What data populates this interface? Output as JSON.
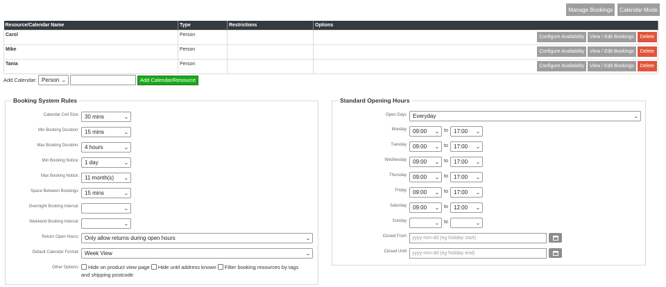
{
  "top_buttons": {
    "manage": "Manage Bookings",
    "mode": "Calendar Mode"
  },
  "table": {
    "headers": [
      "Resource/Calendar Name",
      "Type",
      "Restrictions",
      "Options"
    ],
    "rows": [
      {
        "name": "Carol",
        "type": "Person"
      },
      {
        "name": "Mike",
        "type": "Person"
      },
      {
        "name": "Tania",
        "type": "Person"
      }
    ],
    "actions": {
      "configure": "Configure Availability",
      "view_edit": "View / Edit Bookings",
      "delete": "Delete"
    }
  },
  "add_calendar": {
    "label": "Add Calendar:",
    "type_value": "Person",
    "name_value": "",
    "button": "Add Calendar/Resource"
  },
  "rules": {
    "title": "Booking System Rules",
    "fields": [
      {
        "label": "Calendar Cell Size:",
        "value": "30 mins"
      },
      {
        "label": "Min Booking Duration:",
        "value": "15 mins"
      },
      {
        "label": "Max Booking Duration:",
        "value": "4 hours"
      },
      {
        "label": "Min Booking Notice:",
        "value": "1 day"
      },
      {
        "label": "Max Booking Notice:",
        "value": "11 month(s)"
      },
      {
        "label": "Space Between Bookings:",
        "value": "15 mins"
      },
      {
        "label": "Overnight Booking Interval:",
        "value": ""
      },
      {
        "label": "Weekend Booking Interval:",
        "value": ""
      },
      {
        "label": "Return Open Hours:",
        "value": "Only allow returns during open hours"
      },
      {
        "label": "Default Calendar Format:",
        "value": "Week View"
      }
    ],
    "other_label": "Other Options:",
    "other_opts": [
      "Hide on product view page",
      "Hide until address known",
      "Filter booking resources by tags"
    ],
    "other_tail": "and shipping postcode"
  },
  "hours": {
    "title": "Standard Opening Hours",
    "open_days_label": "Open Days",
    "open_days_value": "Everyday",
    "to": "to",
    "days": [
      {
        "label": "Monday",
        "from": "09:00",
        "to": "17:00"
      },
      {
        "label": "Tuesday",
        "from": "09:00",
        "to": "17:00"
      },
      {
        "label": "Wednesday",
        "from": "09:00",
        "to": "17:00"
      },
      {
        "label": "Thursday",
        "from": "09:00",
        "to": "17:00"
      },
      {
        "label": "Friday",
        "from": "09:00",
        "to": "17:00"
      },
      {
        "label": "Saturday",
        "from": "09:00",
        "to": "12:00"
      },
      {
        "label": "Sunday",
        "from": "",
        "to": ""
      }
    ],
    "closed_from_label": "Closed From",
    "closed_from_placeholder": "yyyy-mm-dd (eg holiday start)",
    "closed_until_label": "Closed Until",
    "closed_until_placeholder": "yyyy-mm-dd (eg holiday end)"
  },
  "icons": {
    "dropdown": "chevron-down-icon",
    "calendar": "calendar-icon",
    "checkbox": "checkbox-icon"
  },
  "colors": {
    "header_bg": "#333a40",
    "delete": "#e0543c",
    "add": "#1da91d",
    "grey_btn": "#9e9e9e"
  }
}
